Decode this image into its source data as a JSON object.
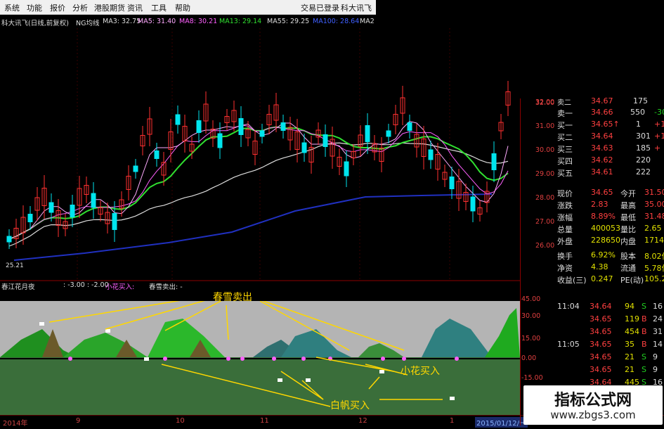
{
  "menubar": {
    "items": [
      "系统",
      "功能",
      "报价",
      "分析",
      "港股期货",
      "资讯",
      "工具",
      "帮助"
    ],
    "right": [
      "交易已登录",
      "科大讯飞"
    ]
  },
  "ma_row": {
    "title": "科大讯飞(日线,前复权)",
    "indicator": "NG均线",
    "ma3": "MA3: 32.75",
    "ma5": "MA5: 31.40",
    "ma8": "MA8: 30.21",
    "ma13": "MA13: 29.14",
    "ma55": "MA55: 29.25",
    "ma100": "MA100: 28.64",
    "ma_more": "MA2"
  },
  "low_label": "25.21",
  "sub_header": {
    "name": "春江花月夜",
    "values": ": -3.00 : -2.00",
    "xiaohua": "小花买入:",
    "chunxue": "春雪卖出: -"
  },
  "price_axis": [
    "32.00",
    "31.00",
    "30.00",
    "29.00",
    "28.00",
    "27.00",
    "26.00"
  ],
  "sub_axis": [
    "45.00",
    "30.00",
    "15.00",
    "0.00",
    "-15.00"
  ],
  "time_axis": [
    "2014年",
    "9",
    "10",
    "11",
    "12",
    "1",
    "2015/01/12/一"
  ],
  "colors": {
    "up": "#ff3030",
    "down": "#00e5ee",
    "green": "#20d020",
    "accent": "#e0e000"
  },
  "quote": {
    "asks": [
      {
        "label": "卖二",
        "price": "34.67",
        "vol": "175",
        "chg": ""
      },
      {
        "label": "卖一",
        "price": "34.66",
        "vol": "550",
        "chg": "-30"
      }
    ],
    "bids": [
      {
        "label": "买一",
        "price": "34.65↑",
        "vol": "1",
        "chg": "+1"
      },
      {
        "label": "买二",
        "price": "34.64",
        "vol": "301",
        "chg": "+14"
      },
      {
        "label": "买三",
        "price": "34.63",
        "vol": "185",
        "chg": "+"
      },
      {
        "label": "买四",
        "price": "34.62",
        "vol": "220",
        "chg": ""
      },
      {
        "label": "买五",
        "price": "34.61",
        "vol": "222",
        "chg": ""
      }
    ],
    "stats": [
      {
        "k1": "现价",
        "v1": "34.65",
        "k2": "今开",
        "v2": "31.50"
      },
      {
        "k1": "涨跌",
        "v1": "2.83",
        "k2": "最高",
        "v2": "35.00"
      },
      {
        "k1": "涨幅",
        "v1": "8.89%",
        "k2": "最低",
        "v2": "31.48"
      },
      {
        "k1": "总量",
        "v1": "400053",
        "k2": "量比",
        "v2": "2.65"
      },
      {
        "k1": "外盘",
        "v1": "228650",
        "k2": "内盘",
        "v2": "171403"
      },
      {
        "k1": "换手",
        "v1": "6.92%",
        "k2": "股本",
        "v2": "8.02亿"
      },
      {
        "k1": "净资",
        "v1": "4.38",
        "k2": "流通",
        "v2": "5.78亿"
      },
      {
        "k1": "收益(三)",
        "v1": "0.247",
        "k2": "PE(动)",
        "v2": "105.2"
      }
    ],
    "ticks": [
      {
        "t": "11:04",
        "p": "34.64",
        "v": "94",
        "f": "S",
        "c": "16"
      },
      {
        "t": "",
        "p": "34.65",
        "v": "119",
        "f": "B",
        "c": "24"
      },
      {
        "t": "",
        "p": "34.65",
        "v": "454",
        "f": "B",
        "c": "31"
      },
      {
        "t": "11:05",
        "p": "34.65",
        "v": "35",
        "f": "B",
        "c": "14"
      },
      {
        "t": "",
        "p": "34.65",
        "v": "21",
        "f": "S",
        "c": "9"
      },
      {
        "t": "",
        "p": "34.65",
        "v": "21",
        "f": "S",
        "c": "9"
      },
      {
        "t": "",
        "p": "34.64",
        "v": "445",
        "f": "S",
        "c": "16"
      }
    ]
  },
  "annotations": {
    "sell": "春雪卖出",
    "xiaohua_buy": "小花买入",
    "baifan_buy": "白帆买入"
  },
  "watermark": {
    "title": "指标公式网",
    "url": "www.zbgs3.com"
  }
}
